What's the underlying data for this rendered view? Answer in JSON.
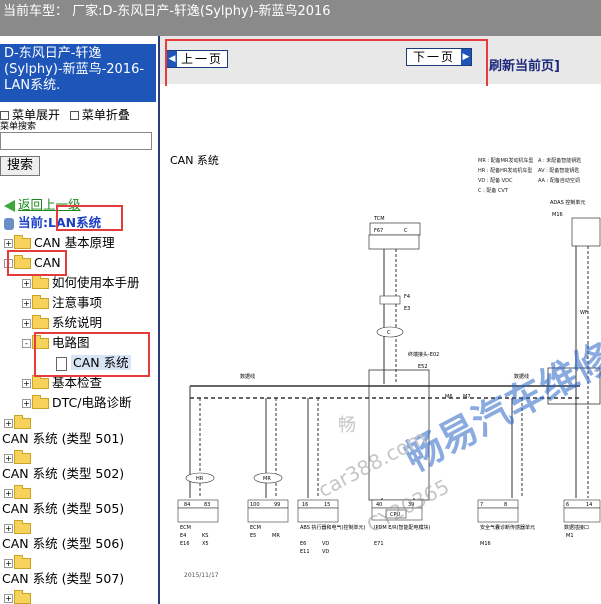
{
  "titlebar": {
    "text": "当前车型：  厂家:D-东风日产-轩逸(Sylphy)-新蓝鸟2016"
  },
  "sidebar": {
    "car_title": "D-东风日产-轩逸(Sylphy)-新蓝鸟-2016- LAN系统.",
    "expand_label": "菜单展开",
    "collapse_label": "菜单折叠",
    "search_label": "菜单搜索",
    "search_placeholder": "",
    "search_button": "搜索",
    "tree": {
      "back": "返回上一级",
      "current": "当前:LAN系统",
      "items": [
        "CAN 基本原理",
        "CAN",
        "如何使用本手册",
        "注意事项",
        "系统说明",
        "电路图",
        "CAN 系统",
        "基本检查",
        "DTC/电路诊断",
        "CAN 系统 (类型 501)",
        "CAN 系统 (类型 502)",
        "CAN 系统 (类型 505)",
        "CAN 系统 (类型 506)",
        "CAN 系统 (类型 507)"
      ]
    }
  },
  "toolbar": {
    "prev_label": "上一页",
    "next_label": "下一页",
    "refresh_label": "刷新当前页]"
  },
  "diagram": {
    "title": "CAN 系统",
    "date": "2015/11/17",
    "watermark_main": "畅易汽车维修平",
    "watermark_url": "car388.com",
    "watermark_code": "CY20365",
    "watermark_small": "畅",
    "legend": [
      "MR : 配备MR发动机车型",
      "HR : 配备HR发动机车型",
      "VD : 配备 VDC",
      "C : 配备 CVT",
      "A : 未配备智能钥匙",
      "AV : 配备智能钥匙",
      "AA : 配备自动空调"
    ],
    "labels": {
      "tcm": "TCM",
      "f67": "F67",
      "c": "C",
      "f4": "F4",
      "e3": "E3",
      "e02": "终端接头-E02",
      "e52": "E52",
      "m6": "M6",
      "m7": "M7",
      "data_line": "数据线",
      "hr": "HR",
      "mr": "MR",
      "ecm": "ECM",
      "abs": "ABS 执行器和电气(控制单元)",
      "ipdm": "IPDM E/R(智能配电模块)",
      "cpu": "CPU",
      "airbag": "安全气囊诊断传感器单元",
      "dlc": "数据插接口",
      "adas": "ADAS 控制单元",
      "m16": "M16",
      "wf": "WF",
      "e4": "E4",
      "e5": "E5",
      "e6": "E6",
      "e11": "E11",
      "e71": "E71",
      "e16": "E16",
      "m": "M",
      "m1": "M1",
      "ks": "KS",
      "x5": "X5",
      "vd": "VD",
      "vd2": "VD",
      "m19": "M19",
      "pins_84_83": [
        "84",
        "83"
      ],
      "pins_100_99": [
        "100",
        "99"
      ],
      "pins_16_15": [
        "16",
        "15"
      ],
      "pins_40_39": [
        "40",
        "39"
      ],
      "pins_7_8": [
        "7",
        "8"
      ],
      "pins_6_14": [
        "6",
        "14"
      ],
      "pins_1_9": [
        "1",
        "9"
      ],
      "pins_8_2": [
        "8",
        "2"
      ]
    }
  }
}
